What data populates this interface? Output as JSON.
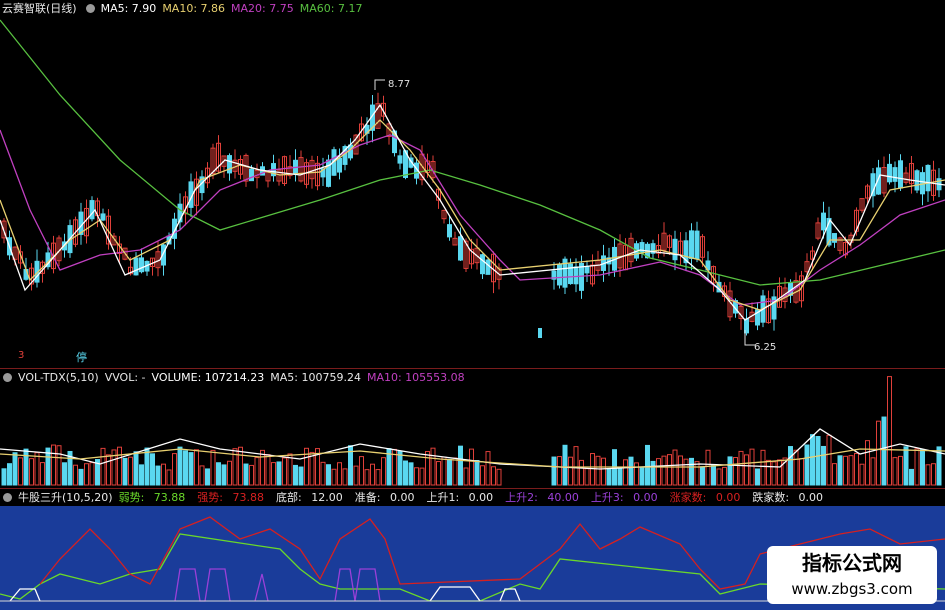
{
  "main": {
    "title": "云赛智联(日线)",
    "ma5": "MA5: 7.90",
    "ma10": "MA10: 7.86",
    "ma20": "MA20: 7.75",
    "ma60": "MA60: 7.17",
    "high_label": "8.77",
    "low_label": "6.25",
    "marker_left": "3",
    "marker_tag": "停"
  },
  "volume": {
    "title": "VOL-TDX(5,10)",
    "vvol": "VVOL: -",
    "volume": "VOLUME: 107214.23",
    "ma5": "MA5: 100759.24",
    "ma10": "MA10: 105553.08"
  },
  "indicator": {
    "title": "牛股三升(10,5,20)",
    "items": [
      {
        "label": "弱势:",
        "value": "73.88"
      },
      {
        "label": "强势:",
        "value": "73.88"
      },
      {
        "label": "底部:",
        "value": "12.00"
      },
      {
        "label": "准备:",
        "value": "0.00"
      },
      {
        "label": "上升1:",
        "value": "0.00"
      },
      {
        "label": "上升2:",
        "value": "40.00"
      },
      {
        "label": "上升3:",
        "value": "0.00"
      },
      {
        "label": "涨家数:",
        "value": "0.00"
      },
      {
        "label": "跌家数:",
        "value": "0.00"
      }
    ]
  },
  "watermark": {
    "title": "指标公式网",
    "url": "www.zbgs3.com"
  },
  "colors": {
    "up": "#e0403a",
    "down": "#5ad8f0",
    "ma5": "#ffffff",
    "ma10": "#e8d070",
    "ma20": "#c040c0",
    "ma60": "#58c040",
    "strong": "#d62020",
    "weak": "#6ad82a",
    "indicator_bg": "#1a3c9a",
    "purple": "#9a40d8"
  },
  "chart_data": {
    "type": "candlestick",
    "high": 8.77,
    "low": 6.25,
    "ma_values": {
      "MA5": 7.9,
      "MA10": 7.86,
      "MA20": 7.75,
      "MA60": 7.17
    },
    "volume_values": {
      "VOLUME": 107214.23,
      "MA5": 100759.24,
      "MA10": 105553.08
    },
    "indicator_values": {
      "弱势": 73.88,
      "强势": 73.88,
      "底部": 12.0,
      "准备": 0.0,
      "上升1": 0.0,
      "上升2": 40.0,
      "上升3": 0.0,
      "涨家数": 0.0,
      "跌家数": 0.0
    }
  }
}
